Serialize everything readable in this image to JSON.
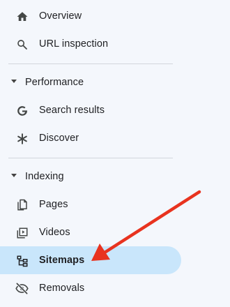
{
  "nav": {
    "top_items": [
      {
        "label": "Overview",
        "icon": "home-icon"
      },
      {
        "label": "URL inspection",
        "icon": "search-icon"
      }
    ],
    "performance": {
      "title": "Performance",
      "items": [
        {
          "label": "Search results",
          "icon": "google-g-icon"
        },
        {
          "label": "Discover",
          "icon": "asterisk-icon"
        }
      ]
    },
    "indexing": {
      "title": "Indexing",
      "items": [
        {
          "label": "Pages",
          "icon": "pages-icon"
        },
        {
          "label": "Videos",
          "icon": "videos-icon"
        },
        {
          "label": "Sitemaps",
          "icon": "sitemap-icon",
          "active": true
        },
        {
          "label": "Removals",
          "icon": "eye-off-icon"
        }
      ]
    }
  },
  "colors": {
    "background": "#f4f7fc",
    "active_item": "#c9e6fb",
    "arrow": "#e8331f",
    "text": "#202124",
    "icon": "#444746"
  }
}
